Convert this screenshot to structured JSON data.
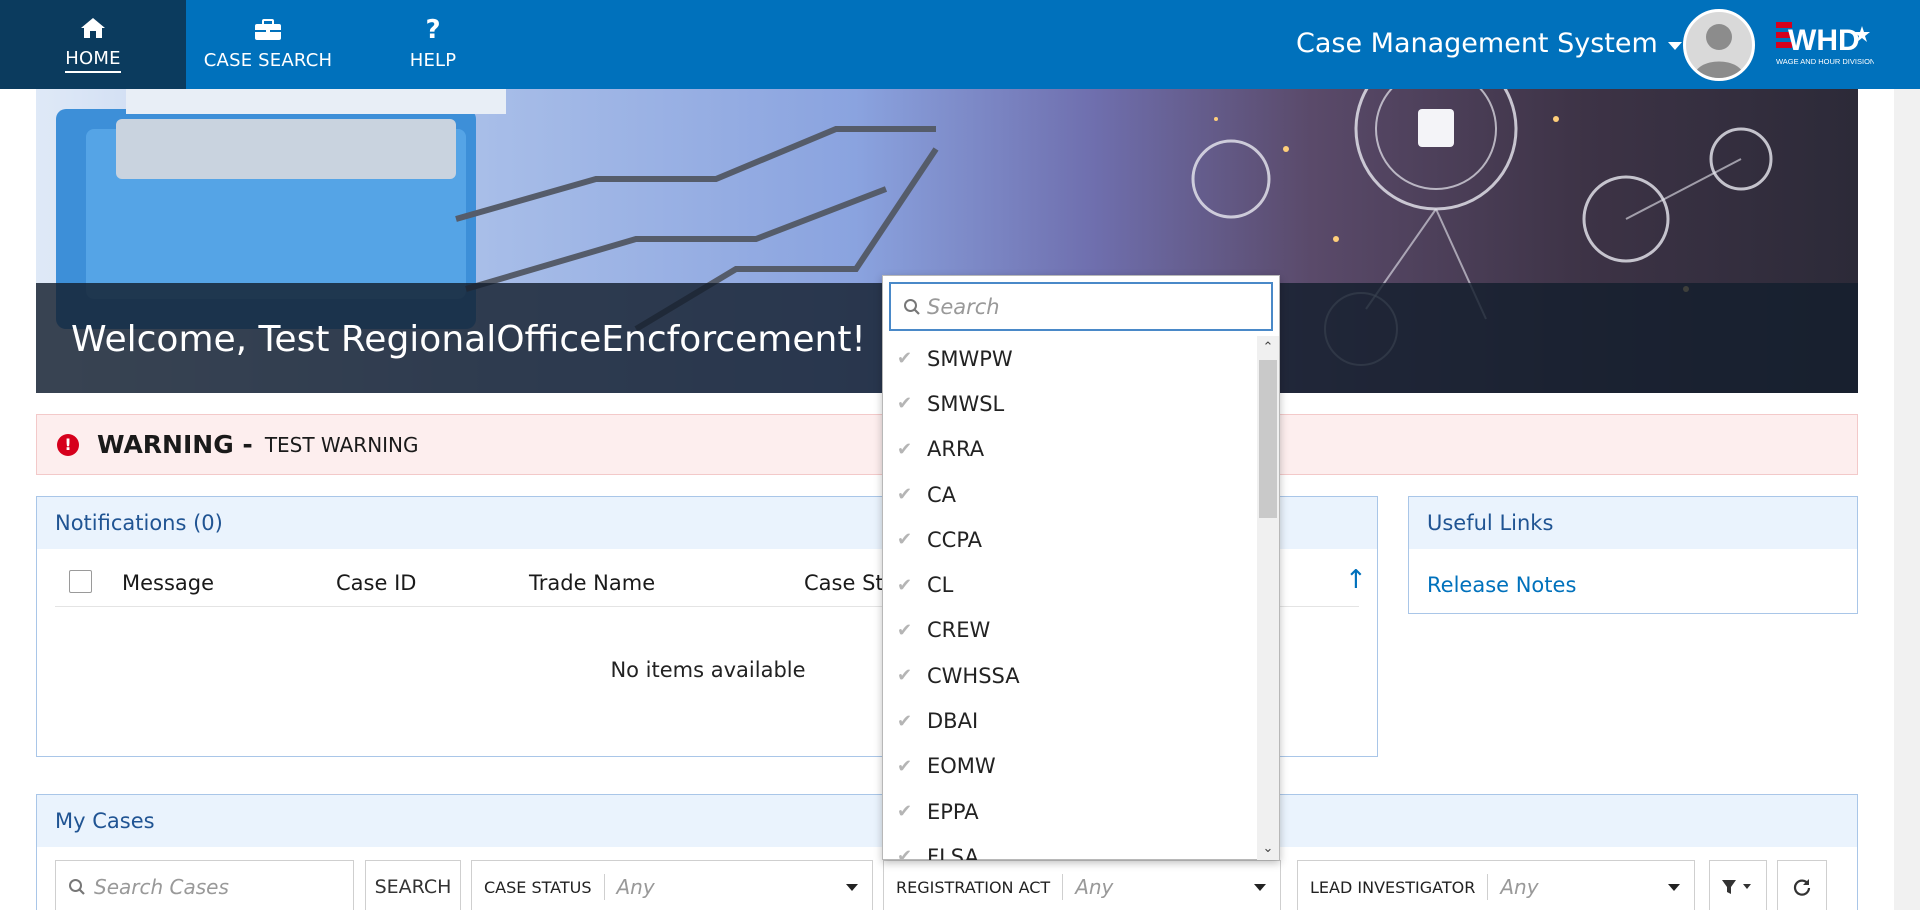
{
  "nav": {
    "home_label": "HOME",
    "case_search_label": "CASE SEARCH",
    "help_label": "HELP",
    "help_glyph": "?",
    "system_title": "Case Management System",
    "logo_text": "WHD",
    "logo_subtext": "WAGE AND HOUR DIVISION"
  },
  "hero": {
    "welcome": "Welcome, Test RegionalOfficeEncforcement!"
  },
  "warning": {
    "icon": "!",
    "title": "WARNING -",
    "text": "TEST WARNING"
  },
  "notifications": {
    "title": "Notifications (0)",
    "columns": [
      "Message",
      "Case ID",
      "Trade Name",
      "Case Status"
    ],
    "sort_glyph": "↑",
    "empty_text": "No items available"
  },
  "useful_links": {
    "title": "Useful Links",
    "links": [
      "Release Notes"
    ]
  },
  "my_cases": {
    "title": "My Cases",
    "search_placeholder": "Search Cases",
    "search_button": "SEARCH",
    "filters": [
      {
        "label": "CASE STATUS",
        "value": "Any"
      },
      {
        "label": "REGISTRATION ACT",
        "value": "Any"
      },
      {
        "label": "LEAD INVESTIGATOR",
        "value": "Any"
      }
    ]
  },
  "registration_dropdown": {
    "search_placeholder": "Search",
    "check_glyph": "✔",
    "items": [
      "SMWPW",
      "SMWSL",
      "ARRA",
      "CA",
      "CCPA",
      "CL",
      "CREW",
      "CWHSSA",
      "DBAI",
      "EOMW",
      "EPPA",
      "FLSA"
    ]
  },
  "colors": {
    "nav_blue": "#0071bc",
    "nav_active": "#0b3b5e",
    "warning_bg": "#fdeeee",
    "warning_icon": "#d6001c",
    "panel_head_bg": "#eaf3fd",
    "link_blue": "#0071bc"
  }
}
